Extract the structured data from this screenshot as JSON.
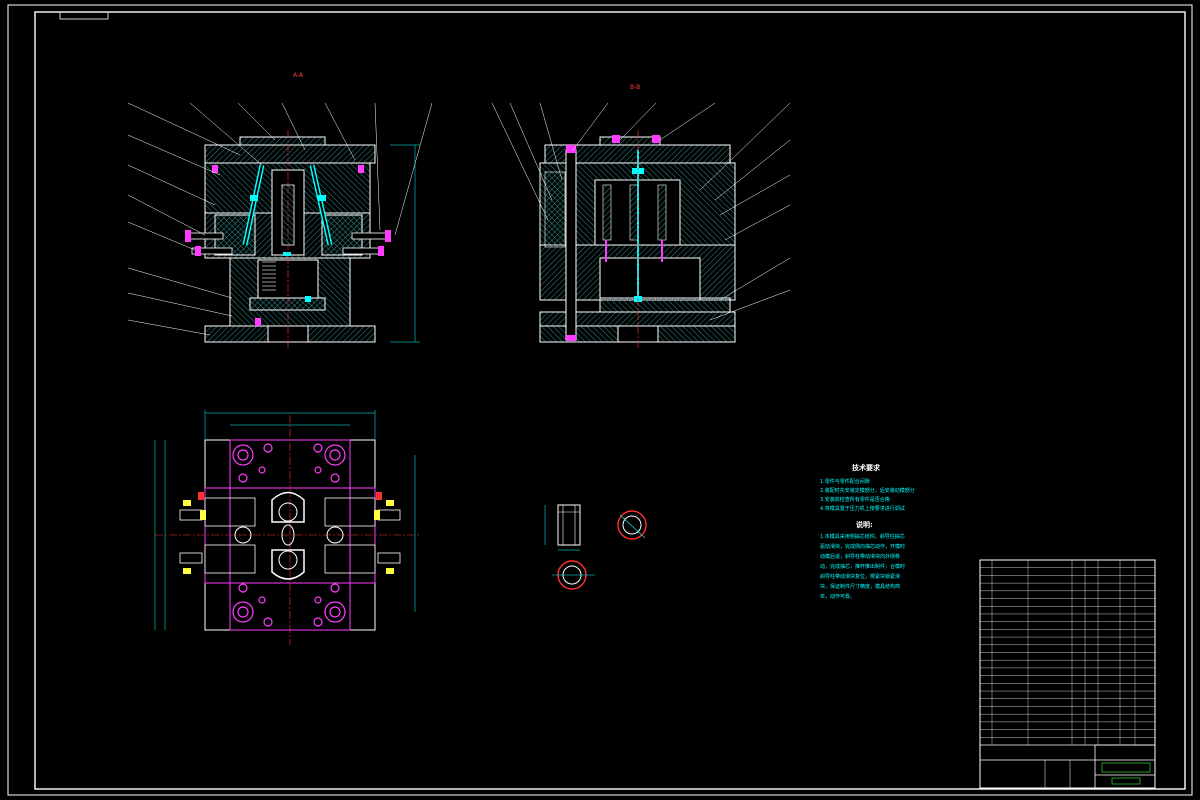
{
  "sheet": {
    "colors": {
      "background": "#000000",
      "frame": "#ffffff",
      "outline": "#ffffff",
      "hatch": "#3aa0a0",
      "cyan": "#00ffff",
      "magenta": "#ff3cff",
      "red": "#ff3030",
      "yellow": "#ffff40",
      "blue": "#4060ff",
      "green": "#40ff40"
    }
  },
  "views": {
    "section_a_label": "A-A",
    "section_b_label": "B-B"
  },
  "notes": {
    "tech_title": "技术要求",
    "tech_lines": [
      "1.零件与零件配合间隙",
      "2.装配时先安装定模部分，后安装动模部分",
      "3.安装前检查所有零件是否合格",
      "4.将模具置于压力机上按要求进行调试"
    ],
    "desc_title": "说明:",
    "desc_lines": [
      "1.本模具采用侧抽芯结构，斜导柱抽芯",
      "驱动滑块，完成侧向抽芯动作，开模时",
      "动模后退，斜导柱带动滑块向外侧移",
      "动，完成抽芯，推杆推出制件，合模时",
      "斜导柱带动滑块复位，楔紧块锁紧滑",
      "块，保证制件尺寸精度，模具结构简",
      "单，动作可靠。"
    ]
  }
}
